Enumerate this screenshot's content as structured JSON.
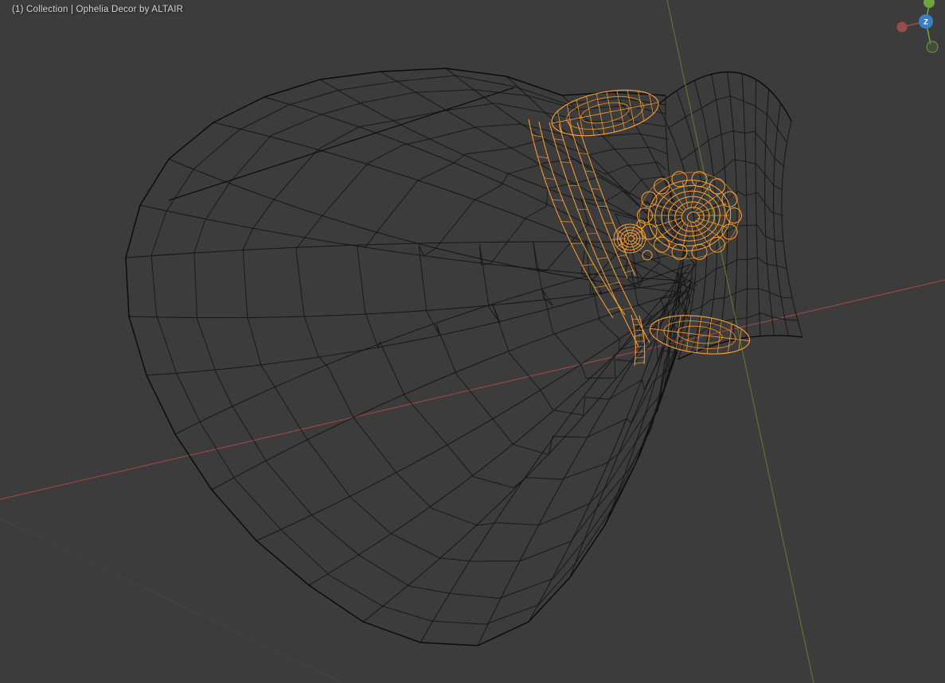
{
  "header": {
    "text": "(1) Collection | Ophelia Decor by ALTAIR"
  },
  "gizmo": {
    "z_label": "Z"
  },
  "colors": {
    "background": "#3c3c3c",
    "wire": "#141414",
    "wire_outline": "#0a0a0a",
    "selected": "#ffa133",
    "selected_dim": "#e08a1e",
    "axis_x": "#b14a4a",
    "axis_y": "#5e7a35",
    "floor_line": "#464646",
    "gizmo_z": "#3a7fc1",
    "gizmo_y": "#6fa33e",
    "gizmo_x_neg": "#9b4b4d",
    "header_text": "#d6d6d6"
  }
}
